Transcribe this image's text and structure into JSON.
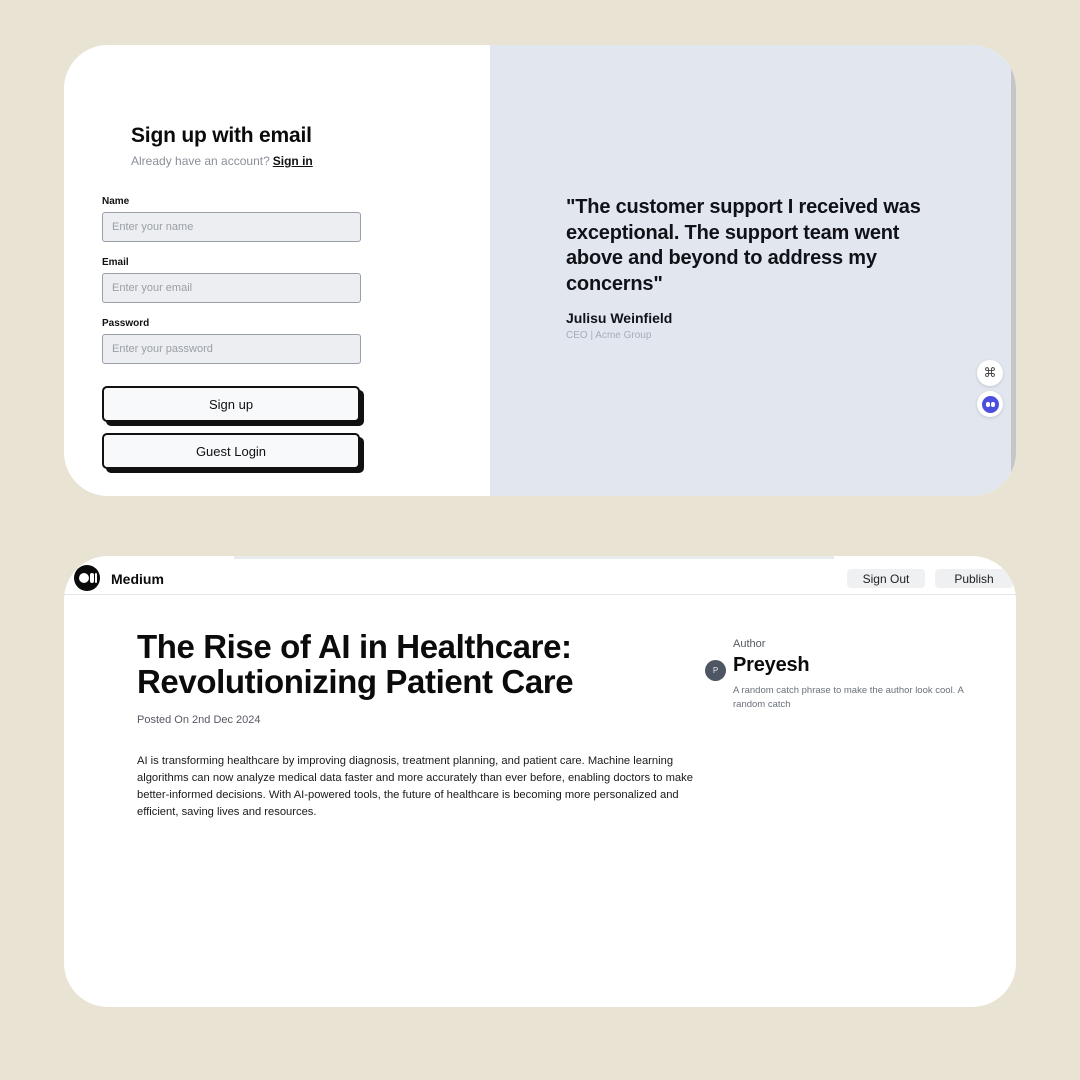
{
  "signup": {
    "title": "Sign up with email",
    "have_account": "Already have an account?",
    "signin_link": "Sign in",
    "fields": [
      {
        "label": "Name",
        "placeholder": "Enter your name"
      },
      {
        "label": "Email",
        "placeholder": "Enter your email"
      },
      {
        "label": "Password",
        "placeholder": "Enter your password"
      }
    ],
    "signup_button": "Sign up",
    "guest_button": "Guest Login"
  },
  "testimonial": {
    "quote": "\"The customer support I received was exceptional. The support team went above and beyond to address my concerns\"",
    "author": "Julisu Weinfield",
    "role": "CEO | Acme Group"
  },
  "floating": {
    "shortcut_icon": "⌘",
    "extension_icon": "extension-face-icon"
  },
  "medium": {
    "brand": "Medium",
    "nav": {
      "sign_out": "Sign Out",
      "publish": "Publish"
    },
    "article": {
      "title": "The Rise of AI in Healthcare: Revolutionizing Patient Care",
      "posted": "Posted On 2nd Dec 2024",
      "body": "AI is transforming healthcare by improving diagnosis, treatment planning, and patient care. Machine learning algorithms can now analyze medical data faster and more accurately than ever before, enabling doctors to make better-informed decisions. With AI-powered tools, the future of healthcare is becoming more personalized and efficient, saving lives and resources."
    },
    "author": {
      "heading": "Author",
      "initial": "P",
      "name": "Preyesh",
      "bio": "A random catch phrase to make the author look cool. A random catch"
    }
  },
  "colors": {
    "page_background": "#e8e3d3",
    "quote_panel": "#e2e7ef",
    "button_border": "#111111"
  }
}
